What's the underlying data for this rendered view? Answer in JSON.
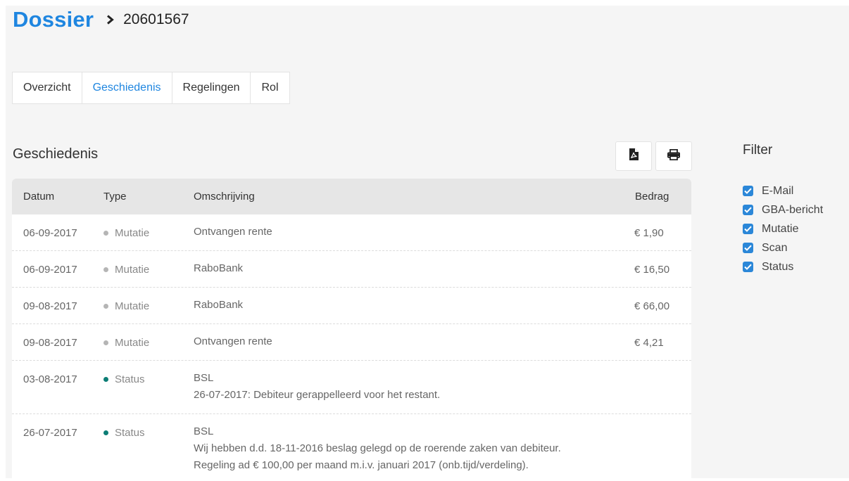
{
  "breadcrumb": {
    "root": "Dossier",
    "separator_icon": "chevron-right-icon",
    "current": "20601567"
  },
  "tabs": [
    {
      "label": "Overzicht",
      "active": false
    },
    {
      "label": "Geschiedenis",
      "active": true
    },
    {
      "label": "Regelingen",
      "active": false
    },
    {
      "label": "Rol",
      "active": false
    }
  ],
  "section": {
    "title": "Geschiedenis",
    "pdf_icon": "file-pdf-icon",
    "print_icon": "print-icon"
  },
  "table": {
    "headers": {
      "date": "Datum",
      "type": "Type",
      "description": "Omschrijving",
      "amount": "Bedrag"
    },
    "rows": [
      {
        "date": "06-09-2017",
        "type": "Mutatie",
        "desc1": "Ontvangen rente",
        "desc2": "",
        "desc3": "",
        "amount": "€ 1,90"
      },
      {
        "date": "06-09-2017",
        "type": "Mutatie",
        "desc1": "RaboBank",
        "desc2": "",
        "desc3": "",
        "amount": "€ 16,50"
      },
      {
        "date": "09-08-2017",
        "type": "Mutatie",
        "desc1": "RaboBank",
        "desc2": "",
        "desc3": "",
        "amount": "€ 66,00"
      },
      {
        "date": "09-08-2017",
        "type": "Mutatie",
        "desc1": "Ontvangen rente",
        "desc2": "",
        "desc3": "",
        "amount": "€ 4,21"
      },
      {
        "date": "03-08-2017",
        "type": "Status",
        "desc1": "BSL",
        "desc2": "26-07-2017: Debiteur gerappelleerd voor het restant.",
        "desc3": "",
        "amount": ""
      },
      {
        "date": "26-07-2017",
        "type": "Status",
        "desc1": "BSL",
        "desc2": "Wij hebben d.d. 18-11-2016 beslag gelegd op de roerende zaken van debiteur.",
        "desc3": "Regeling ad € 100,00 per maand m.i.v. januari 2017 (onb.tijd/verdeling).",
        "amount": ""
      }
    ]
  },
  "colors": {
    "accent": "#1f86e0",
    "status_dot": "#0c7d75",
    "mutatie_dot": "#b5b5b5",
    "checkbox": "#2b87d8"
  },
  "filter": {
    "title": "Filter",
    "items": [
      {
        "label": "E-Mail",
        "checked": true
      },
      {
        "label": "GBA-bericht",
        "checked": true
      },
      {
        "label": "Mutatie",
        "checked": true
      },
      {
        "label": "Scan",
        "checked": true
      },
      {
        "label": "Status",
        "checked": true
      }
    ]
  }
}
